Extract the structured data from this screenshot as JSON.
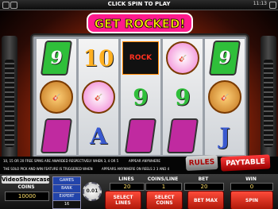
{
  "topbar": {
    "message": "CLICK SPIN TO PLAY",
    "time": "11:13"
  },
  "title": "GET ROCKED!",
  "reels": [
    [
      "9",
      "guitarist",
      "gem-purple"
    ],
    [
      "10",
      "guitar",
      "A"
    ],
    [
      "ROCK",
      "9",
      "gem-purple"
    ],
    [
      "guitar",
      "9",
      "gem-purple"
    ],
    [
      "9",
      "guitarist",
      "J"
    ]
  ],
  "info": {
    "line1": "10, 15 OR 20 FREE SPINS ARE AWARDED RESPECTIVELY WHEN 3, 4 OR 5",
    "line1_tail": "APPEAR ANYWHERE",
    "line2": "THE SOLO PICK AND WIN FEATURE IS TRIGGERED WHEN",
    "line2_tail": "APPEARS ANYWHERE ON REELS 2 3 AND 4"
  },
  "guitar_buttons": {
    "rules": "RULES",
    "paytable": "PAYTABLE"
  },
  "bottom": {
    "brand": "VideoShowcase",
    "coins_label": "COINS",
    "coins_value": "10000",
    "games_label": "GAMES",
    "bank_label": "BANK",
    "expert_label": "EXPERT",
    "expert_value": "16",
    "chip_value": "0.01",
    "lines_label": "LINES",
    "lines_value": "20",
    "coins_line_label": "COINS/LINE",
    "coins_line_value": "1",
    "bet_label": "BET",
    "bet_value": "20",
    "win_label": "WIN",
    "win_value": "0",
    "select_lines": "SELECT LINES",
    "select_coins": "SELECT COINS",
    "bet_max": "BET MAX",
    "spin": "SPIN"
  },
  "colors": {
    "accent": "#e03010",
    "gold": "#ffd23a"
  }
}
